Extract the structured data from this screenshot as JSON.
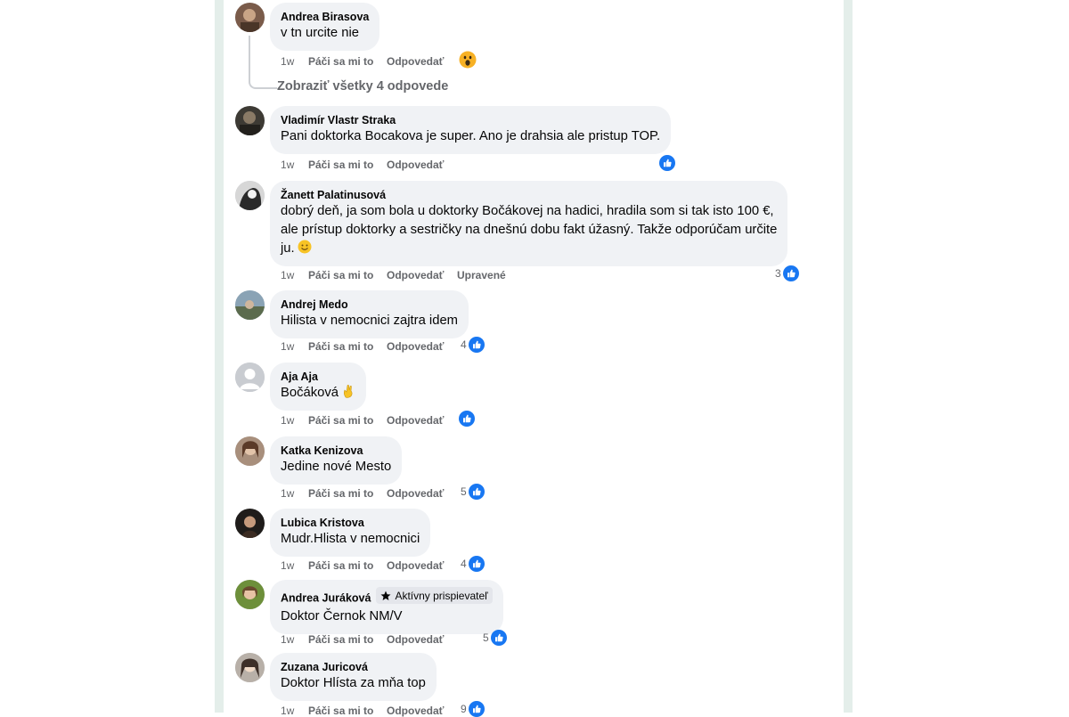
{
  "show_replies_label": "Zobraziť všetky 4 odpovede",
  "actions": {
    "like": "Páči sa mi to",
    "reply": "Odpovedať",
    "edited": "Upravené"
  },
  "comments": [
    {
      "author": "Andrea Birasova",
      "text": "v tn urcite nie",
      "time": "1w",
      "reaction": "wow-icon",
      "reaction_count": ""
    },
    {
      "author": "Vladimír Vlastr Straka",
      "text": "Pani doktorka Bocakova je super. Ano je drahsia ale pristup TOP.",
      "time": "1w",
      "reaction": "like-icon",
      "reaction_count": ""
    },
    {
      "author": "Žanett Palatinusová",
      "text_lines": [
        "dobrý deň, ja som bola u doktorky Bočákovej na hadici, hradila som si tak isto 100 €,",
        "ale prístup doktorky a sestričky na dnešnú dobu fakt úžasný. Takže odporúčam určite",
        "ju."
      ],
      "time": "1w",
      "edited": true,
      "reaction": "like-icon",
      "reaction_count": "3"
    },
    {
      "author": "Andrej Medo",
      "text": "Hilista v nemocnici zajtra idem",
      "time": "1w",
      "reaction": "like-icon",
      "reaction_count": "4"
    },
    {
      "author": "Aja Aja",
      "text": "Bočáková",
      "time": "1w",
      "reaction": "like-icon",
      "reaction_count": ""
    },
    {
      "author": "Katka Kenizova",
      "text": "Jedine nové Mesto",
      "time": "1w",
      "reaction": "like-icon",
      "reaction_count": "5"
    },
    {
      "author": "Lubica Kristova",
      "text": "Mudr.Hlista v nemocnici",
      "time": "1w",
      "reaction": "like-icon",
      "reaction_count": "4"
    },
    {
      "author": "Andrea Juráková",
      "badge": "Aktívny prispievateľ",
      "text": "Doktor Černok NM/V",
      "time": "1w",
      "reaction": "like-icon",
      "reaction_count": "5"
    },
    {
      "author": "Zuzana Juricová",
      "text": "Doktor Hlísta za mňa top",
      "time": "1w",
      "reaction": "like-icon",
      "reaction_count": "9"
    }
  ],
  "colors": {
    "like_blue": "#1877f2",
    "bubble": "#f0f2f5",
    "meta_gray": "#65676b"
  }
}
